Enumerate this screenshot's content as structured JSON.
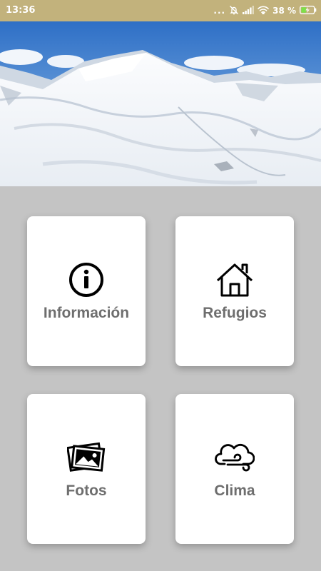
{
  "status_bar": {
    "time": "13:36",
    "dots": "...",
    "battery_percent": "38 %",
    "icons": [
      "notifications-muted-icon",
      "signal-icon",
      "wifi-icon",
      "battery-charging-icon"
    ]
  },
  "hero": {
    "image": "snowy-mountain-photo"
  },
  "menu": {
    "items": [
      {
        "label": "Información",
        "icon": "info-icon"
      },
      {
        "label": "Refugios",
        "icon": "house-icon"
      },
      {
        "label": "Fotos",
        "icon": "photos-icon"
      },
      {
        "label": "Clima",
        "icon": "cloud-wind-icon"
      }
    ]
  },
  "colors": {
    "status_bar": "#c2b27c",
    "background": "#c4c4c4",
    "card": "#ffffff",
    "label": "#6e6e6e"
  }
}
